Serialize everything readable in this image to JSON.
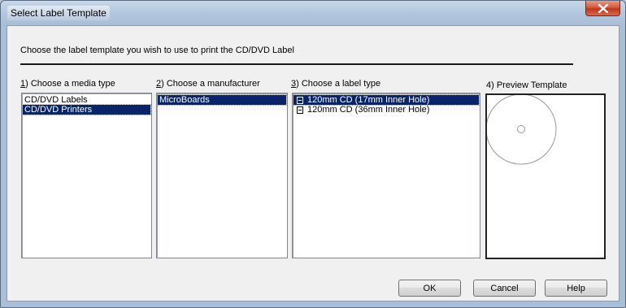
{
  "window": {
    "title": "Select Label Template"
  },
  "instruction": "Choose the label template you wish to use to print the CD/DVD Label",
  "steps": {
    "media": {
      "num": "1",
      "rest": ") Choose a media type"
    },
    "manufacturer": {
      "num": "2",
      "rest": ") Choose a manufacturer"
    },
    "label_type": {
      "num": "3",
      "rest": ") Choose a label type"
    },
    "preview": "4) Preview Template"
  },
  "media_types": {
    "items": [
      "CD/DVD Labels",
      "CD/DVD Printers"
    ],
    "selected": "CD/DVD Printers"
  },
  "manufacturers": {
    "items": [
      "MicroBoards"
    ],
    "selected": "MicroBoards"
  },
  "label_types": {
    "items": [
      "120mm CD  (17mm Inner Hole)",
      "120mm CD  (36mm Inner Hole)"
    ],
    "selected": "120mm CD  (17mm Inner Hole)",
    "icon": "label-template-icon"
  },
  "buttons": {
    "ok": "OK",
    "cancel": "Cancel",
    "help": "Help"
  },
  "colors": {
    "selection": "#0a246a",
    "close_button": "#c2351c"
  }
}
